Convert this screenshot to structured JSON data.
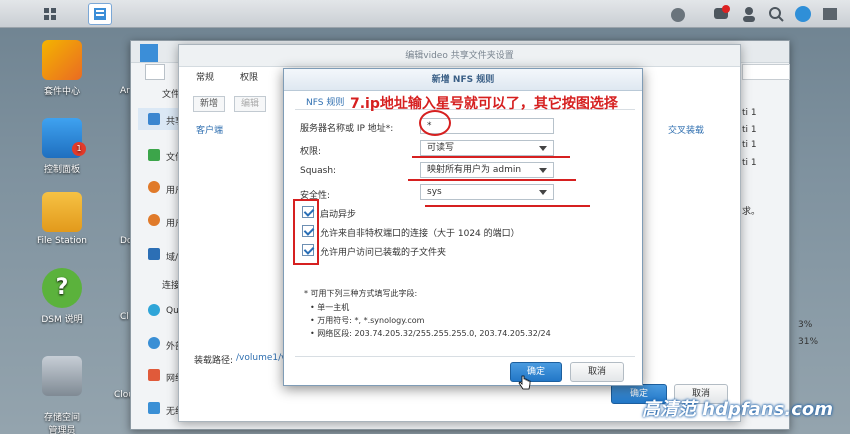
{
  "desktop_icons": [
    "套件中心",
    "控制面板",
    "File Station",
    "DSM 说明",
    "存储空间\n管理员"
  ],
  "partial_icons": [
    "Ar",
    "Do",
    "Cl",
    "Cloud"
  ],
  "badge_count": "1",
  "back_window": {
    "title": "编辑video 共享文件夹设置",
    "sidebar": [
      "文件",
      "共享",
      "文件",
      "用户",
      "用户",
      "域/",
      "连接",
      "Qu",
      "外部",
      "网络",
      "无线"
    ],
    "right_cells": [
      "ti 1",
      "ti 1",
      "ti 1",
      "ti 1",
      "求。",
      "3%",
      "31%"
    ]
  },
  "mid_window": {
    "tabs": [
      "常规",
      "权限"
    ],
    "toolbar": [
      "新增",
      "编辑"
    ],
    "col_client": "客户端",
    "col_cross": "交叉装载",
    "path_label": "装载路径:",
    "path_value": "/volume1/vi",
    "ok_label": "确定",
    "cancel_label": "取消"
  },
  "dialog": {
    "title": "新增 NFS 规则",
    "tab": "NFS 规则",
    "labels": {
      "server": "服务器名称或 IP 地址*:",
      "permission": "权限:",
      "squash": "Squash:",
      "security": "安全性:"
    },
    "values": {
      "server": "*",
      "permission": "可读写",
      "squash": "映射所有用户为 admin",
      "security": "sys"
    },
    "checkboxes": [
      "启动异步",
      "允许来自非特权端口的连接（大于 1024 的端口）",
      "允许用户访问已装载的子文件夹"
    ],
    "help_title": "* 可用下列三种方式填写此字段:",
    "help_items": [
      "单一主机",
      "万用符号: *, *.synology.com",
      "网络区段: 203.74.205.32/255.255.255.0, 203.74.205.32/24"
    ],
    "ok_label": "确定",
    "cancel_label": "取消"
  },
  "annotation": "7.ip地址输入星号就可以了，其它按图选择",
  "watermark": "高清范 hdpfans.com"
}
